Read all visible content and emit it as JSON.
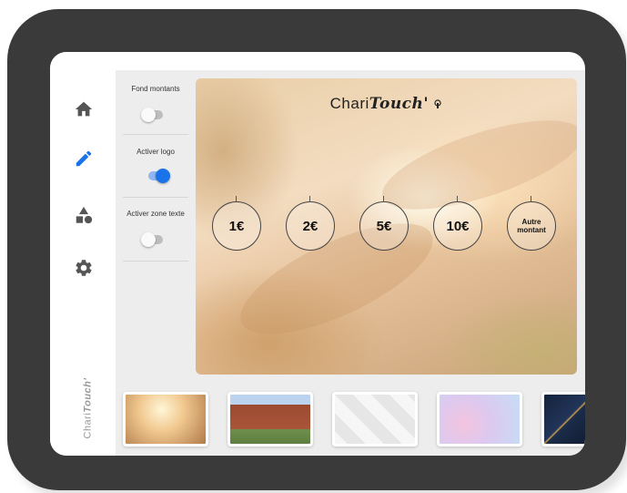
{
  "nav": {
    "items": [
      {
        "name": "home-icon"
      },
      {
        "name": "pencil-icon"
      },
      {
        "name": "shapes-icon"
      },
      {
        "name": "gear-icon"
      }
    ],
    "accent": "#1a73e8",
    "logo_vertical_prefix": "Chari",
    "logo_vertical_bold": "Touch'"
  },
  "toggles": [
    {
      "label": "Fond montants",
      "on": false
    },
    {
      "label": "Activer logo",
      "on": true
    },
    {
      "label": "Activer zone texte",
      "on": false
    }
  ],
  "preview": {
    "logo_prefix": "Chari",
    "logo_bold": "Touch'",
    "amounts": [
      "1€",
      "2€",
      "5€",
      "10€"
    ],
    "other_amount_line1": "Autre",
    "other_amount_line2": "montant"
  },
  "thumbnails": [
    {
      "name": "thumb-hands-light"
    },
    {
      "name": "thumb-brick-building"
    },
    {
      "name": "thumb-white-geometric"
    },
    {
      "name": "thumb-pastel-watercolor"
    },
    {
      "name": "thumb-navy-gold"
    }
  ]
}
